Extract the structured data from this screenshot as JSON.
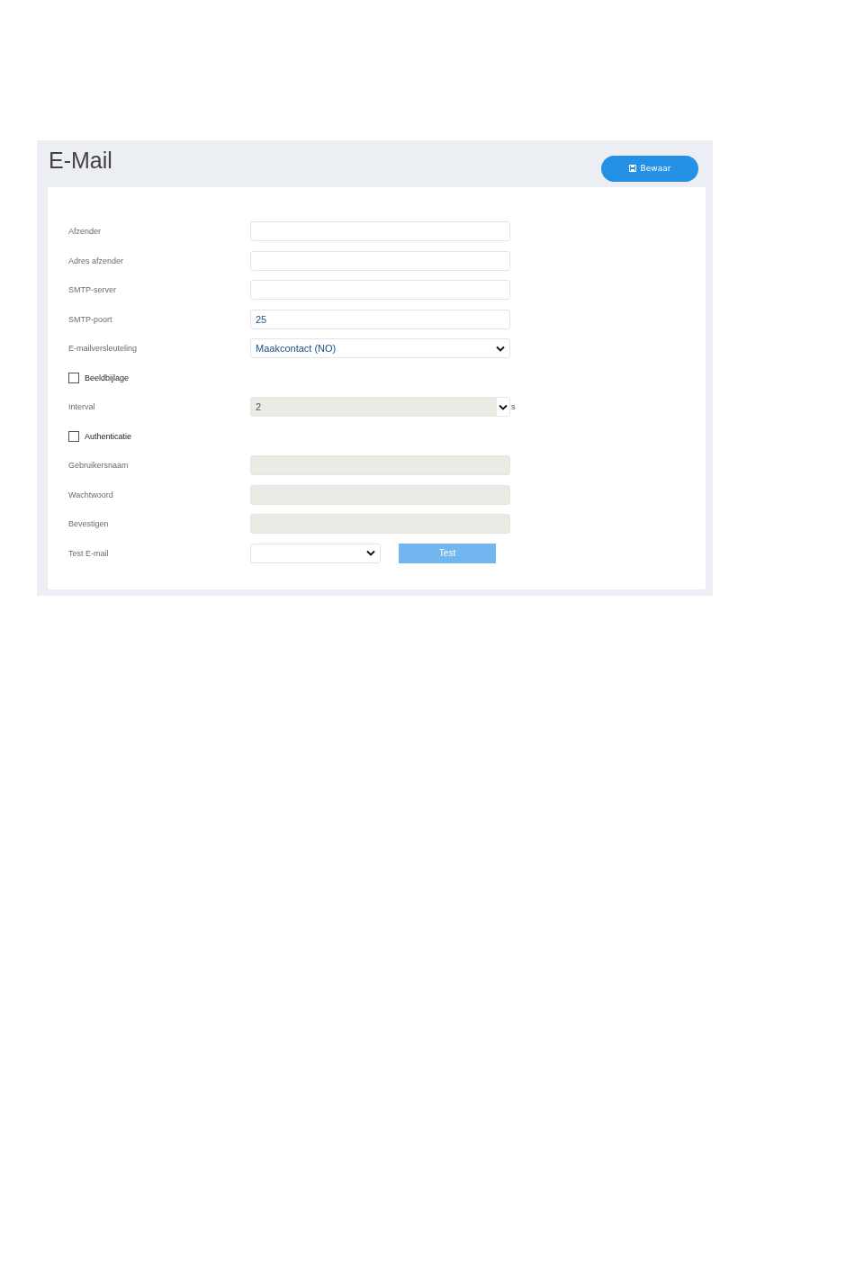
{
  "page": {
    "title": "E-Mail",
    "save_button": "Bewaar"
  },
  "form": [
    {
      "kind": "text",
      "label": "Afzender",
      "disabled": false
    },
    {
      "kind": "text",
      "label": "Adres afzender",
      "disabled": false
    },
    {
      "kind": "text",
      "label": "SMTP-server",
      "disabled": false
    },
    {
      "kind": "text",
      "label": "SMTP-poort",
      "value": "25",
      "disabled": false
    },
    {
      "kind": "select",
      "label": "E-mailversleuteling",
      "value": "Maakcontact (NO)",
      "disabled": false
    },
    {
      "kind": "checkbox",
      "label": "Beeldbijlage",
      "checked": false
    },
    {
      "kind": "spinner",
      "label": "Interval",
      "value": "2",
      "unit": "s",
      "disabled": true
    },
    {
      "kind": "checkbox",
      "label": "Authenticatie",
      "checked": false
    },
    {
      "kind": "text",
      "label": "Gebruikersnaam",
      "disabled": true
    },
    {
      "kind": "text",
      "label": "Wachtwoord",
      "disabled": true
    },
    {
      "kind": "text",
      "label": "Bevestigen",
      "disabled": true
    },
    {
      "kind": "test",
      "label": "Test E-mail",
      "button": "Test",
      "disabled": true
    }
  ]
}
